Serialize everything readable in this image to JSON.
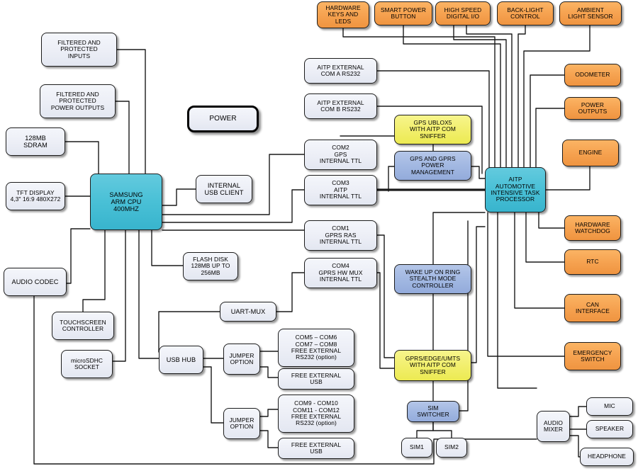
{
  "diagram": {
    "title": "AITP Automotive Intensive Task Processor Hardware Block Diagram",
    "colors": {
      "grey": "#eceef6",
      "orange": "#f6a351",
      "cyan": "#49c0d6",
      "yellow": "#f2ef6e",
      "blue": "#a2b8e2",
      "wire": "#1a1a1a",
      "border": "#1c1c1c"
    }
  },
  "nodes": {
    "filtered_inputs": {
      "label": "FILTERED AND\nPROTECTED\nINPUTS",
      "lines": [
        "FILTERED AND",
        "PROTECTED",
        "INPUTS"
      ],
      "color": "grey"
    },
    "filtered_power_outputs": {
      "label": "FILTERED AND\nPROTECTED\nPOWER OUTPUTS",
      "lines": [
        "FILTERED AND",
        "PROTECTED",
        "POWER OUTPUTS"
      ],
      "color": "grey"
    },
    "sdram": {
      "label": "128MB SDRAM",
      "lines": [
        "128MB",
        "SDRAM"
      ],
      "color": "grey"
    },
    "tft_display": {
      "label": "TFT DISPLAY 4,3\" 16:9 480X272",
      "lines": [
        "TFT DISPLAY",
        "4,3\" 16:9 480X272"
      ],
      "color": "grey"
    },
    "samsung_cpu": {
      "label": "SAMSUNG ARM CPU 400MHZ",
      "lines": [
        "SAMSUNG",
        "ARM CPU",
        "400MHZ"
      ],
      "color": "cyan"
    },
    "audio_codec": {
      "label": "AUDIO CODEC",
      "lines": [
        "AUDIO CODEC"
      ],
      "color": "grey"
    },
    "touchscreen_controller": {
      "label": "TOUCHSCREEN CONTROLLER",
      "lines": [
        "TOUCHSCREEN",
        "CONTROLLER"
      ],
      "color": "grey"
    },
    "microsdhc_socket": {
      "label": "microSDHC SOCKET",
      "lines": [
        "microSDHC",
        "SOCKET"
      ],
      "color": "grey"
    },
    "power": {
      "label": "POWER",
      "lines": [
        "POWER"
      ],
      "color": "power"
    },
    "internal_usb_client": {
      "label": "INTERNAL USB CLIENT",
      "lines": [
        "INTERNAL",
        "USB CLIENT"
      ],
      "color": "grey"
    },
    "flash_disk": {
      "label": "FLASH DISK 128MB UP TO 256MB",
      "lines": [
        "FLASH DISK",
        "128MB UP TO",
        "256MB"
      ],
      "color": "grey"
    },
    "usb_hub": {
      "label": "USB HUB",
      "lines": [
        "USB HUB"
      ],
      "color": "grey"
    },
    "uart_mux": {
      "label": "UART-MUX",
      "lines": [
        "UART-MUX"
      ],
      "color": "grey"
    },
    "jumper_option_1": {
      "label": "JUMPER OPTION",
      "lines": [
        "JUMPER",
        "OPTION"
      ],
      "color": "grey"
    },
    "jumper_option_2": {
      "label": "JUMPER OPTION",
      "lines": [
        "JUMPER",
        "OPTION"
      ],
      "color": "grey"
    },
    "com5_com8": {
      "label": "COM5 – COM6 COM7 – COM8 FREE EXTERNAL RS232 (option)",
      "lines": [
        "COM5 – COM6",
        "COM7 – COM8",
        "FREE EXTERNAL",
        "RS232 (option)"
      ],
      "color": "grey"
    },
    "free_external_usb_1": {
      "label": "FREE EXTERNAL USB",
      "lines": [
        "FREE EXTERNAL",
        "USB"
      ],
      "color": "grey"
    },
    "com9_com12": {
      "label": "COM9 - COM10 COM11 - COM12 FREE EXTERNAL RS232 (option)",
      "lines": [
        "COM9 - COM10",
        "COM11 - COM12",
        "FREE EXTERNAL",
        "RS232 (option)"
      ],
      "color": "grey"
    },
    "free_external_usb_2": {
      "label": "FREE EXTERNAL USB",
      "lines": [
        "FREE EXTERNAL",
        "USB"
      ],
      "color": "grey"
    },
    "aitp_external_com_a": {
      "label": "AITP EXTERNAL COM A RS232",
      "lines": [
        "AITP EXTERNAL",
        "COM A RS232"
      ],
      "color": "grey"
    },
    "aitp_external_com_b": {
      "label": "AITP EXTERNAL COM B RS232",
      "lines": [
        "AITP EXTERNAL",
        "COM B RS232"
      ],
      "color": "grey"
    },
    "com2_gps": {
      "label": "COM2 GPS INTERNAL TTL",
      "lines": [
        "COM2",
        "GPS",
        "INTERNAL TTL"
      ],
      "color": "grey"
    },
    "com3_aitp": {
      "label": "COM3 AITP INTERNAL TTL",
      "lines": [
        "COM3",
        "AITP",
        "INTERNAL TTL"
      ],
      "color": "grey"
    },
    "com1_gprs_ras": {
      "label": "COM1 GPRS RAS INTERNAL TTL",
      "lines": [
        "COM1",
        "GPRS RAS",
        "INTERNAL TTL"
      ],
      "color": "grey"
    },
    "com4_gprs_hw_mux": {
      "label": "COM4 GPRS HW MUX INTERNAL TTL",
      "lines": [
        "COM4",
        "GPRS HW MUX",
        "INTERNAL TTL"
      ],
      "color": "grey"
    },
    "gps_ublox5": {
      "label": "GPS UBLOX5 WITH AITP COM SNIFFER",
      "lines": [
        "GPS UBLOX5",
        "WITH AITP COM",
        "SNIFFER"
      ],
      "color": "yellow"
    },
    "gps_gprs_power_mgmt": {
      "label": "GPS AND GPRS POWER MANAGEMENT",
      "lines": [
        "GPS AND GPRS",
        "POWER",
        "MANAGEMENT"
      ],
      "color": "blue"
    },
    "wake_up_on_ring": {
      "label": "WAKE UP ON RING STEALTH MODE CONTROLLER",
      "lines": [
        "WAKE UP ON RING",
        "STEALTH MODE",
        "CONTROLLER"
      ],
      "color": "blue"
    },
    "gprs_edge_umts": {
      "label": "GPRS/EDGE/UMTS WITH AITP COM SNIFFER",
      "lines": [
        "GPRS/EDGE/UMTS",
        "WITH AITP COM",
        "SNIFFER"
      ],
      "color": "yellow"
    },
    "sim_switcher": {
      "label": "SIM SWITCHER",
      "lines": [
        "SIM",
        "SWITCHER"
      ],
      "color": "blue"
    },
    "sim1": {
      "label": "SIM1",
      "lines": [
        "SIM1"
      ],
      "color": "grey"
    },
    "sim2": {
      "label": "SIM2",
      "lines": [
        "SIM2"
      ],
      "color": "grey"
    },
    "aitp_processor": {
      "label": "AITP AUTOMOTIVE INTENSIVE TASK PROCESSOR",
      "lines": [
        "AITP",
        "AUTOMOTIVE",
        "INTENSIVE TASK",
        "PROCESSOR"
      ],
      "color": "cyan"
    },
    "hardware_keys_leds": {
      "label": "HARDWARE KEYS AND LEDS",
      "lines": [
        "HARDWARE",
        "KEYS AND",
        "LEDS"
      ],
      "color": "orange"
    },
    "smart_power_button": {
      "label": "SMART POWER BUTTON",
      "lines": [
        "SMART POWER",
        "BUTTON"
      ],
      "color": "orange"
    },
    "high_speed_digital_io": {
      "label": "HIGH SPEED DIGITAL I/O",
      "lines": [
        "HIGH SPEED",
        "DIGITAL I/O"
      ],
      "color": "orange"
    },
    "back_light_control": {
      "label": "BACK-LIGHT CONTROL",
      "lines": [
        "BACK-LIGHT",
        "CONTROL"
      ],
      "color": "orange"
    },
    "ambient_light_sensor": {
      "label": "AMBIENT LIGHT SENSOR",
      "lines": [
        "AMBIENT",
        "LIGHT SENSOR"
      ],
      "color": "orange"
    },
    "odometer": {
      "label": "ODOMETER",
      "lines": [
        "ODOMETER"
      ],
      "color": "orange"
    },
    "power_outputs": {
      "label": "POWER OUTPUTS",
      "lines": [
        "POWER",
        "OUTPUTS"
      ],
      "color": "orange"
    },
    "engine": {
      "label": "ENGINE",
      "lines": [
        "ENGINE"
      ],
      "color": "orange"
    },
    "hardware_watchdog": {
      "label": "HARDWARE WATCHDOG",
      "lines": [
        "HARDWARE",
        "WATCHDOG"
      ],
      "color": "orange"
    },
    "rtc": {
      "label": "RTC",
      "lines": [
        "RTC"
      ],
      "color": "orange"
    },
    "can_interface": {
      "label": "CAN INTERFACE",
      "lines": [
        "CAN",
        "INTERFACE"
      ],
      "color": "orange"
    },
    "emergency_switch": {
      "label": "EMERGENCY SWITCH",
      "lines": [
        "EMERGENCY",
        "SWITCH"
      ],
      "color": "orange"
    },
    "audio_mixer": {
      "label": "AUDIO MIXER",
      "lines": [
        "AUDIO",
        "MIXER"
      ],
      "color": "grey"
    },
    "mic": {
      "label": "MIC",
      "lines": [
        "MIC"
      ],
      "color": "grey"
    },
    "speaker": {
      "label": "SPEAKER",
      "lines": [
        "SPEAKER"
      ],
      "color": "grey"
    },
    "headphone": {
      "label": "HEADPHONE",
      "lines": [
        "HEADPHONE"
      ],
      "color": "grey"
    }
  }
}
